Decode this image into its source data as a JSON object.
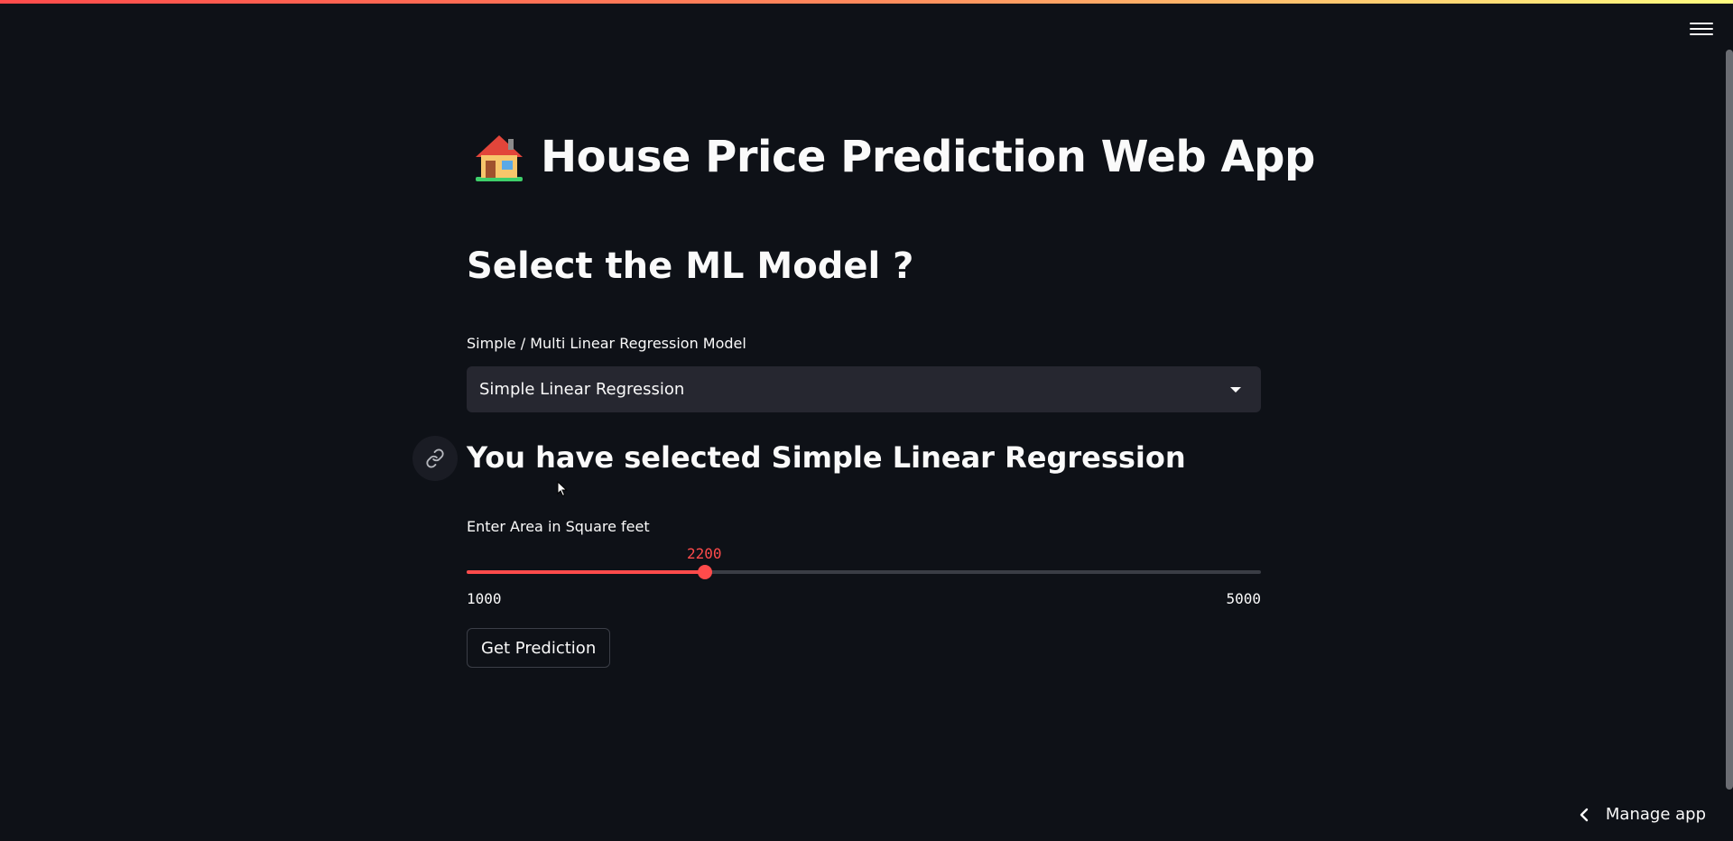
{
  "app": {
    "title_emoji": "🏠",
    "title": "House Price Prediction Web App"
  },
  "header": {
    "menu_icon": "hamburger-menu-icon"
  },
  "main": {
    "section_heading": "Select the ML Model ?",
    "model_select": {
      "label": "Simple / Multi Linear Regression Model",
      "value": "Simple Linear Regression"
    },
    "selected_heading": "You have selected Simple Linear Regression",
    "area_slider": {
      "label": "Enter Area in Square feet",
      "value": 2200,
      "value_text": "2200",
      "min": 1000,
      "min_text": "1000",
      "max": 5000,
      "max_text": "5000"
    },
    "predict_button": "Get Prediction"
  },
  "footer": {
    "manage_app": "Manage app"
  },
  "colors": {
    "background": "#0e1117",
    "accent": "#ff4b4b",
    "input_bg": "#262730",
    "text": "#fafafa"
  }
}
